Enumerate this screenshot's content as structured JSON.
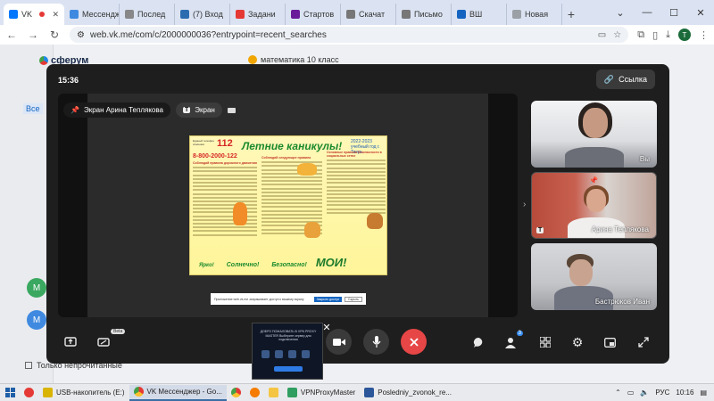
{
  "browser": {
    "tabs": [
      {
        "label": "VK",
        "color": "#0077ff",
        "active": true
      },
      {
        "label": "Мессендж",
        "color": "#3f8ae0"
      },
      {
        "label": "Послед",
        "color": "#888888"
      },
      {
        "label": "(7) Вход",
        "color": "#2b6cb0"
      },
      {
        "label": "Задани",
        "color": "#e53935"
      },
      {
        "label": "Стартов",
        "color": "#6a1b9a"
      },
      {
        "label": "Скачат",
        "color": "#777777"
      },
      {
        "label": "Письмо",
        "color": "#777777"
      },
      {
        "label": "ВШ",
        "color": "#1565c0"
      },
      {
        "label": "Новая",
        "color": "#9aa0a6"
      }
    ],
    "url": "web.vk.me/com/c/2000000036?entrypoint=recent_searches",
    "profile_letter": "Т"
  },
  "background": {
    "logo": "сферум",
    "chat_title": "математика 10 класс",
    "vse_label": "Все",
    "circles": [
      {
        "letter": "М",
        "color": "#3aa860"
      },
      {
        "letter": "М",
        "color": "#3f8ae0"
      }
    ],
    "checkbox_label": "Только непрочитанные"
  },
  "call": {
    "time": "15:36",
    "link_button": "Ссылка",
    "screen_owner_label": "Экран Арина Теплякова",
    "screen_tab": "Экран",
    "screen_tab_chip": "T",
    "poster": {
      "num": "112",
      "tel_label": "Единый телефон спасения",
      "title": "Летние каникулы!",
      "year": "2022-2023 учебный год г. Тверь",
      "phone": "8-800-2000-122",
      "col1_head": "Соблюдай правила дорожного движения",
      "col2_head": "Соблюдай следующие правила",
      "col3_head": "Основные правила безопасности в социальных сетях",
      "bottom_1": "Ярко!",
      "bottom_2": "Солнечно!",
      "bottom_3": "Безопасно!",
      "bottom_4": "МОИ!"
    },
    "notice_text": "Приложение web.vk.me запрашивает доступ к вашему экрану",
    "notice_allow": "Закрыть доступ",
    "notice_hide": "Скрыть",
    "participants": [
      {
        "name": "Вы"
      },
      {
        "name": "Арина Теплякова",
        "badge": "T"
      },
      {
        "name": "Бастрюков Иван"
      }
    ],
    "beta_label": "Beta",
    "people_badge": "3",
    "preview_text": "ДОБРО ПОЖАЛОВАТЬ В VPN PROXY MASTER Выберите сервер для подключения"
  },
  "taskbar": {
    "items": [
      {
        "label": "USB-накопитель (E:)",
        "color": "#d9b400"
      },
      {
        "label": "VK Мессенджер - Go...",
        "color": "#3f8ae0",
        "active": true
      },
      {
        "label": "VPNProxyMaster",
        "color": "#2f9e60"
      },
      {
        "label": "Posledniy_zvonok_re...",
        "color": "#2b579a"
      }
    ],
    "lang": "РУС",
    "time": "10:16"
  },
  "colors": {
    "accent": "#0077ff",
    "end_call": "#e64646",
    "overlay_bg": "#1e1e1e"
  }
}
